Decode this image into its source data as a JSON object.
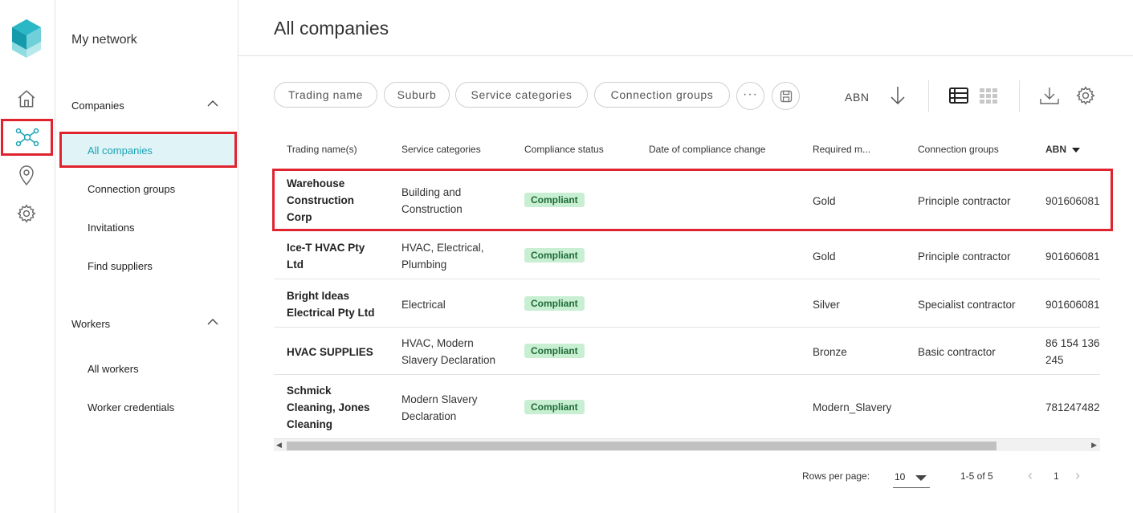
{
  "sidebar": {
    "title": "My network",
    "sections": [
      {
        "label": "Companies",
        "items": [
          "All companies",
          "Connection groups",
          "Invitations",
          "Find suppliers"
        ]
      },
      {
        "label": "Workers",
        "items": [
          "All workers",
          "Worker credentials"
        ]
      }
    ]
  },
  "page": {
    "title": "All companies"
  },
  "filters": {
    "chips": [
      "Trading name",
      "Suburb",
      "Service categories",
      "Connection groups"
    ],
    "sort_label": "ABN"
  },
  "table": {
    "columns": [
      "Trading name(s)",
      "Service categories",
      "Compliance status",
      "Date of compliance change",
      "Required m...",
      "Connection groups",
      "ABN"
    ],
    "rows": [
      {
        "name": [
          "Warehouse",
          "Construction",
          "Corp"
        ],
        "categories": [
          "Building and",
          "Construction"
        ],
        "status": "Compliant",
        "date": "",
        "required": "Gold",
        "group": "Principle contractor",
        "abn": [
          "901606081"
        ]
      },
      {
        "name": [
          "Ice-T HVAC Pty",
          "Ltd"
        ],
        "categories": [
          "HVAC, Electrical,",
          "Plumbing"
        ],
        "status": "Compliant",
        "date": "",
        "required": "Gold",
        "group": "Principle contractor",
        "abn": [
          "901606081"
        ]
      },
      {
        "name": [
          "Bright Ideas",
          "Electrical Pty Ltd"
        ],
        "categories": [
          "Electrical"
        ],
        "status": "Compliant",
        "date": "",
        "required": "Silver",
        "group": "Specialist contractor",
        "abn": [
          "901606081"
        ]
      },
      {
        "name": [
          "HVAC SUPPLIES"
        ],
        "categories": [
          "HVAC, Modern",
          "Slavery Declaration"
        ],
        "status": "Compliant",
        "date": "",
        "required": "Bronze",
        "group": "Basic contractor",
        "abn": [
          "86 154 136",
          "245"
        ]
      },
      {
        "name": [
          "Schmick",
          "Cleaning, Jones",
          "Cleaning"
        ],
        "categories": [
          "Modern Slavery",
          "Declaration"
        ],
        "status": "Compliant",
        "date": "",
        "required": "Modern_Slavery",
        "group": "",
        "abn": [
          "781247482"
        ]
      }
    ]
  },
  "pagination": {
    "rows_per_page_label": "Rows per page:",
    "rows_per_page": "10",
    "range": "1-5 of 5",
    "page": "1"
  },
  "colors": {
    "accent": "#1aa3b4",
    "highlight": "#e0242f",
    "badge_bg": "#c9efd3",
    "badge_text": "#1e6b35"
  }
}
